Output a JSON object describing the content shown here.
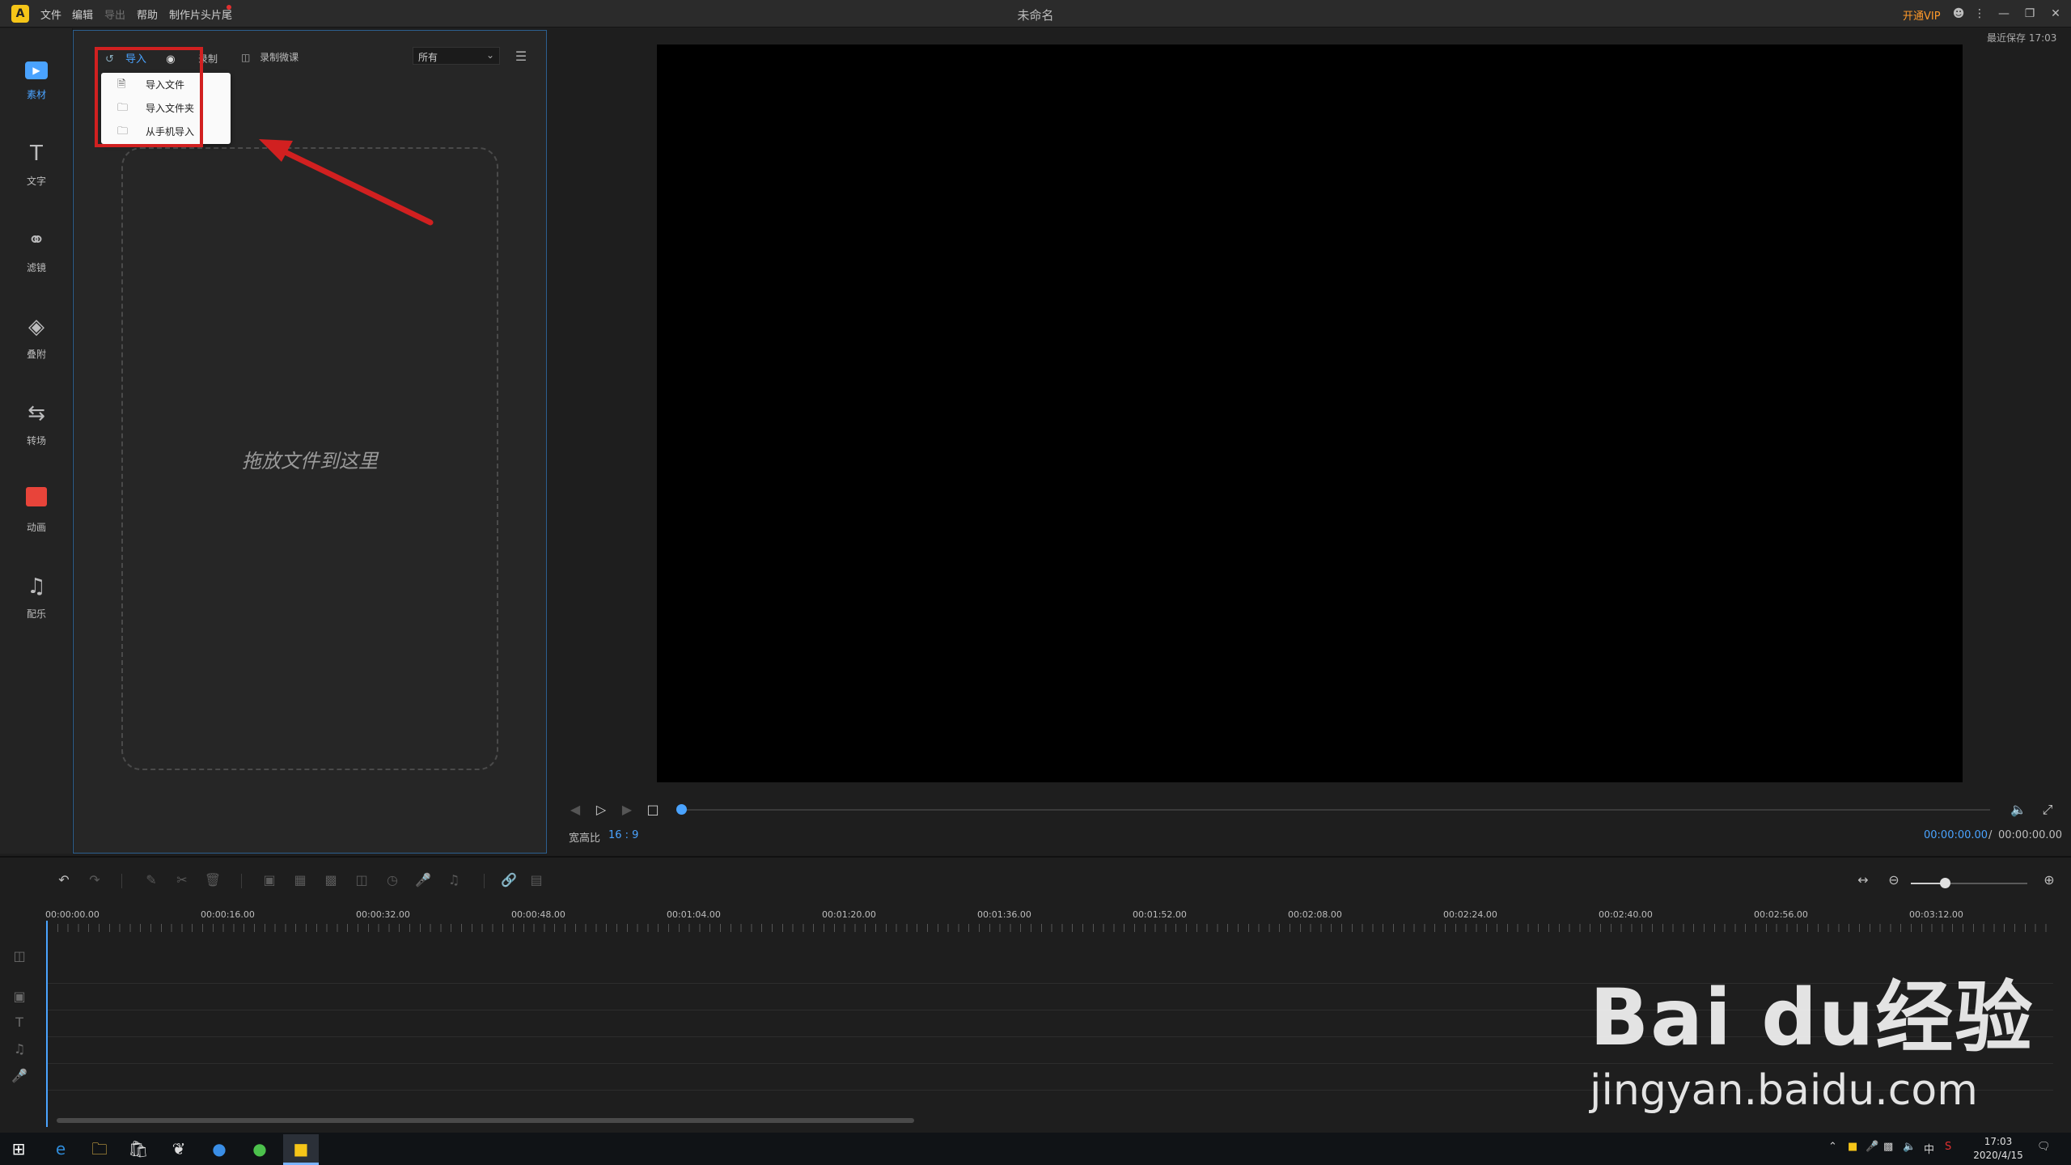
{
  "app": {
    "logo_text": "A",
    "title": "未命名",
    "menus": [
      "文件",
      "编辑",
      "导出",
      "帮助",
      "制作片头片尾"
    ],
    "vip_label": "开通VIP",
    "saved_status": "最近保存 17:03"
  },
  "sidebar": {
    "items": [
      {
        "label": "素材",
        "icon": "play-box-icon"
      },
      {
        "label": "文字",
        "icon": "text-icon"
      },
      {
        "label": "滤镜",
        "icon": "filter-icon"
      },
      {
        "label": "叠附",
        "icon": "overlay-icon"
      },
      {
        "label": "转场",
        "icon": "transition-icon"
      },
      {
        "label": "动画",
        "icon": "film-icon"
      },
      {
        "label": "配乐",
        "icon": "music-icon"
      }
    ]
  },
  "panel": {
    "import_label": "导入",
    "record_label": "录制",
    "micro_label": "录制微课",
    "filter_value": "所有",
    "drop_text": "拖放文件到这里",
    "dropdown": [
      "导入文件",
      "导入文件夹",
      "从手机导入"
    ]
  },
  "preview": {
    "ratio_label": "宽高比",
    "ratio_value": "16 : 9",
    "time_current": "00:00:00.00",
    "time_sep": "/",
    "time_total": "00:00:00.00"
  },
  "timeline": {
    "ticks": [
      "00:00:00.00",
      "00:00:16.00",
      "00:00:32.00",
      "00:00:48.00",
      "00:01:04.00",
      "00:01:20.00",
      "00:01:36.00",
      "00:01:52.00",
      "00:02:08.00",
      "00:02:24.00",
      "00:02:40.00",
      "00:02:56.00",
      "00:03:12.00"
    ]
  },
  "taskbar": {
    "time": "17:03",
    "date": "2020/4/15",
    "ime": "中"
  },
  "watermark": {
    "main": "Bai du经验",
    "sub": "jingyan.baidu.com"
  },
  "colors": {
    "accent": "#4aa3ff",
    "vip": "#ff9a2a",
    "highlight": "#d12020"
  }
}
